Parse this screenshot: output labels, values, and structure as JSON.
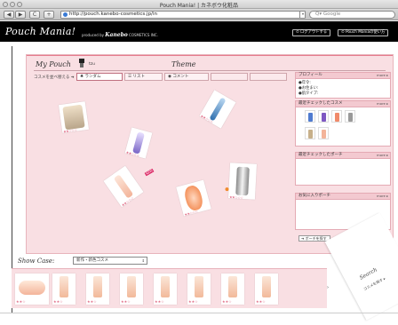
{
  "browser": {
    "title": "Pouch Mania! | カネボウ化粧品",
    "nav_back": "◀",
    "nav_forward": "▶",
    "nav_reload": "C",
    "nav_add": "+",
    "url": "http://pouch.kanebo-cosmetics.jp/in",
    "search_placeholder": "Q▾ Google"
  },
  "header": {
    "logo": "Pouch Mania!",
    "produced_prefix": "produced by",
    "produced_brand": "Kanebo",
    "produced_suffix": "COSMETICS INC.",
    "logout_label": "⊙ ログアウトする",
    "help_label": "⊙ Pouch Maniaの使い方"
  },
  "pouch": {
    "heading": "My Pouch",
    "username": "tzu",
    "theme_label": "Theme",
    "sort_label": "コスメを並べ替える ➜",
    "sort_buttons": [
      {
        "label": "ランダム",
        "icon": "scatter-icon"
      },
      {
        "label": "リスト",
        "icon": "list-icon"
      },
      {
        "label": "コメント",
        "icon": "comment-icon"
      }
    ],
    "products": [
      {
        "name": "compact-powder",
        "stars": "★★☆☆☆",
        "color_a": "#efe0c8",
        "color_b": "#b9a58a"
      },
      {
        "name": "perfume-bottle",
        "stars": "★★☆☆☆",
        "color_a": "#e8e0ff",
        "color_b": "#7a66c6"
      },
      {
        "name": "blue-tube",
        "stars": "★★☆☆☆",
        "color_a": "#bcd9f2",
        "color_b": "#2f6fae"
      },
      {
        "name": "cream-tube",
        "stars": "★★☆☆☆",
        "color_a": "#fde6da",
        "color_b": "#f3b49a",
        "badge": "NEW"
      },
      {
        "name": "orange-bottle",
        "stars": "★★☆☆☆",
        "color_a": "#ffd8c0",
        "color_b": "#f07a3a"
      },
      {
        "name": "silver-bottle",
        "stars": "★★☆☆☆",
        "color_a": "#f3f3f3",
        "color_b": "#8a8a8a"
      }
    ]
  },
  "sidebar": {
    "profile_title": "プロフィール",
    "profile_more": "more ▸",
    "profile_lines": [
      "●年令:",
      "●お住まい:",
      "●肌タイプ:"
    ],
    "checked_title": "最近チェックしたコスメ",
    "checked_more": "more ▸",
    "checked_thumbs": [
      {
        "color": "#4f7bd0"
      },
      {
        "color": "#7e58c2"
      },
      {
        "color": "#f08a6a"
      },
      {
        "color": "#9a9a9a"
      },
      {
        "color": "#c7b08a"
      },
      {
        "color": "#f3b49a"
      }
    ],
    "recent_pouch_title": "最近チェックしたポーチ",
    "recent_pouch_more": "more ▸",
    "favorite_title": "お気に入りポーチ",
    "favorite_more": "more ▸",
    "make_pouch_label": "➜ ポーチを探す"
  },
  "showcase": {
    "label": "Show Case:",
    "select_value": "新作・新色コスメ",
    "items": [
      {
        "stars": "★★☆"
      },
      {
        "stars": "★★☆"
      },
      {
        "stars": "★★☆"
      },
      {
        "stars": "★★☆"
      },
      {
        "stars": "★★☆"
      },
      {
        "stars": "★★☆"
      },
      {
        "stars": "★★☆"
      },
      {
        "stars": "★★☆"
      }
    ],
    "next_label": "›"
  },
  "search_peel": {
    "title": "Search",
    "subtitle": "コスメを探す ▸"
  }
}
